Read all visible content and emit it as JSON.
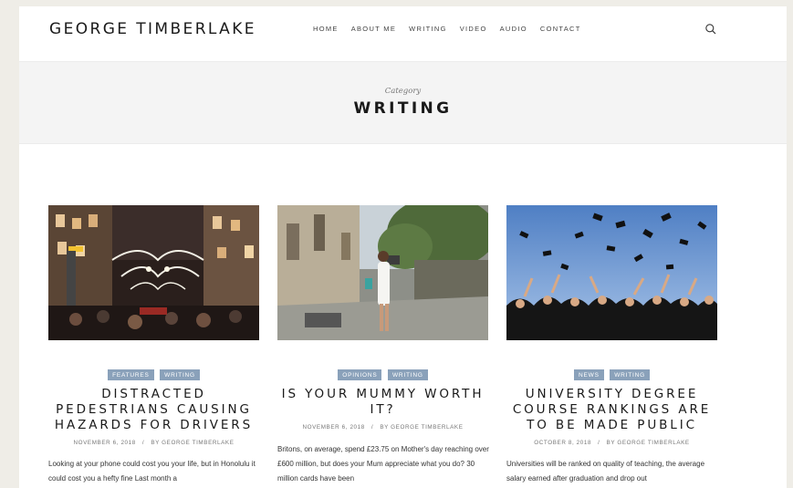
{
  "site": {
    "title": "GEORGE TIMBERLAKE"
  },
  "nav": {
    "items": [
      "HOME",
      "ABOUT ME",
      "WRITING",
      "VIDEO",
      "AUDIO",
      "CONTACT"
    ]
  },
  "search": {
    "icon": "search-icon"
  },
  "category": {
    "label": "Category",
    "title": "WRITING"
  },
  "posts": [
    {
      "tags": [
        "FEATURES",
        "WRITING"
      ],
      "title": "DISTRACTED PEDESTRIANS CAUSING HAZARDS FOR DRIVERS",
      "date": "NOVEMBER 6, 2018",
      "author": "BY GEORGE TIMBERLAKE",
      "excerpt": "Looking at your phone could cost you your life, but in Honolulu it could cost you a hefty fine Last month a",
      "image": "street-christmas-lights"
    },
    {
      "tags": [
        "OPINIONS",
        "WRITING"
      ],
      "title": "IS YOUR MUMMY WORTH IT?",
      "date": "NOVEMBER 6, 2018",
      "author": "BY GEORGE TIMBERLAKE",
      "excerpt": "Britons, on average, spend £23.75 on Mother's day reaching over £600 million, but does your Mum appreciate what you do? 30 million cards have been",
      "image": "woman-on-cobbled-street"
    },
    {
      "tags": [
        "NEWS",
        "WRITING"
      ],
      "title": "UNIVERSITY DEGREE COURSE RANKINGS ARE TO BE MADE PUBLIC",
      "date": "OCTOBER 8, 2018",
      "author": "BY GEORGE TIMBERLAKE",
      "excerpt": "Universities will be ranked on quality of teaching, the average salary earned after graduation and drop out",
      "image": "graduates-throwing-caps"
    }
  ],
  "colors": {
    "tag_bg": "#8aa1ba",
    "page_bg": "#efede7",
    "banner_bg": "#f4f4f4"
  }
}
